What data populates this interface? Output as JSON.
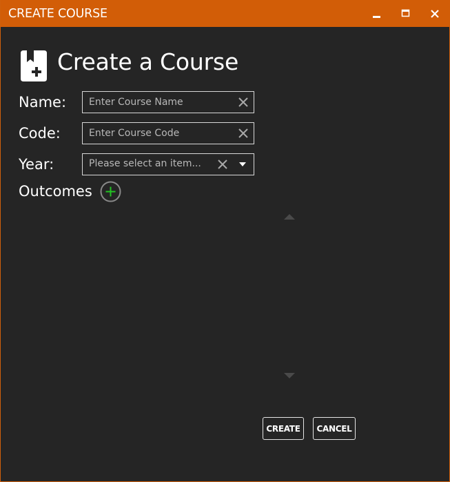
{
  "window": {
    "title": "CREATE COURSE",
    "colors": {
      "titlebar": "#d25d07",
      "background": "#252525",
      "accent_plus": "#22c522"
    },
    "controls": {
      "minimize_icon": "minimize-icon",
      "maximize_icon": "maximize-icon",
      "close_icon": "close-icon"
    }
  },
  "header": {
    "icon": "book-add-icon",
    "title": "Create a Course"
  },
  "form": {
    "name": {
      "label": "Name:",
      "placeholder": "Enter Course Name",
      "value": ""
    },
    "code": {
      "label": "Code:",
      "placeholder": "Enter Course Code",
      "value": ""
    },
    "year": {
      "label": "Year:",
      "selected": "Please select an item..."
    },
    "outcomes": {
      "label": "Outcomes",
      "add_icon": "add-circle-icon",
      "items": []
    }
  },
  "actions": {
    "create_label": "CREATE",
    "cancel_label": "CANCEL"
  }
}
